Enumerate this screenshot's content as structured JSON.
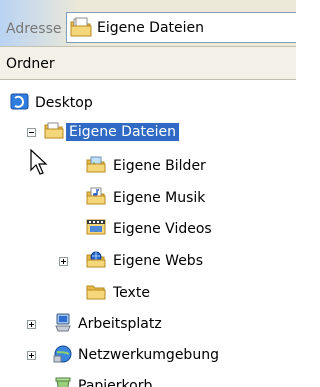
{
  "address": {
    "label": "Adresse",
    "value": "Eigene Dateien",
    "icon": "documents-folder-icon"
  },
  "folders": {
    "header": "Ordner"
  },
  "tree": {
    "desktop": "Desktop",
    "eigene_dateien": "Eigene Dateien",
    "eigene_bilder": "Eigene Bilder",
    "eigene_musik": "Eigene Musik",
    "eigene_videos": "Eigene Videos",
    "eigene_webs": "Eigene Webs",
    "texte": "Texte",
    "arbeitsplatz": "Arbeitsplatz",
    "netzwerkumgebung": "Netzwerkumgebung",
    "papierkorb": "Papierkorb"
  },
  "colors": {
    "selection": "#316ac5",
    "folder": "#f5d77b"
  }
}
